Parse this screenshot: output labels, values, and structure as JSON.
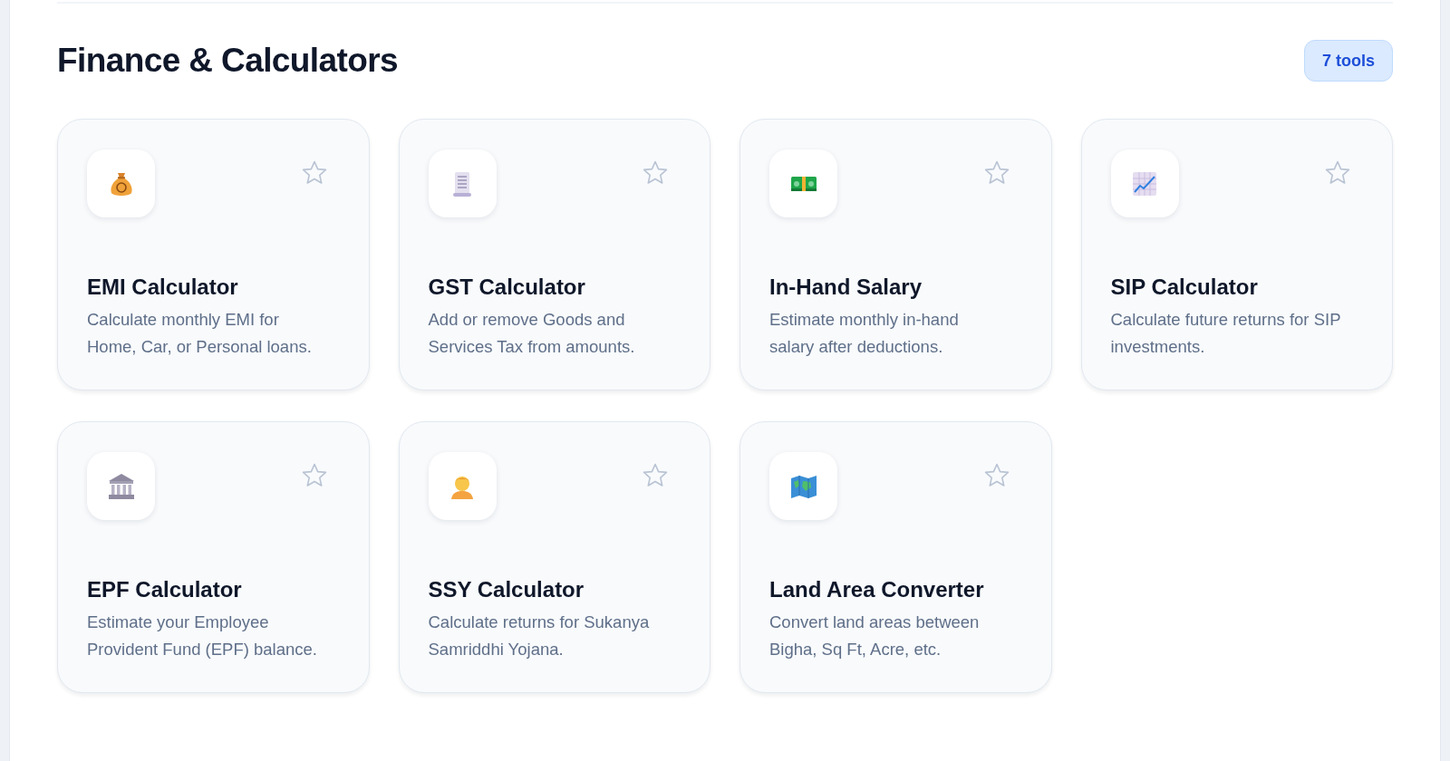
{
  "section": {
    "title": "Finance & Calculators",
    "count_badge": "7 tools"
  },
  "tools": [
    {
      "name": "EMI Calculator",
      "description": "Calculate monthly EMI for Home, Car, or Personal loans.",
      "favorite": false
    },
    {
      "name": "GST Calculator",
      "description": "Add or remove Goods and Services Tax from amounts.",
      "favorite": false
    },
    {
      "name": "In-Hand Salary",
      "description": "Estimate monthly in-hand salary after deductions.",
      "favorite": false
    },
    {
      "name": "SIP Calculator",
      "description": "Calculate future returns for SIP investments.",
      "favorite": false
    },
    {
      "name": "EPF Calculator",
      "description": "Estimate your Employee Provident Fund (EPF) balance.",
      "favorite": false
    },
    {
      "name": "SSY Calculator",
      "description": "Calculate returns for Sukanya Samriddhi Yojana.",
      "favorite": false
    },
    {
      "name": "Land Area Converter",
      "description": "Convert land areas between Bigha, Sq Ft, Acre, etc.",
      "favorite": false
    }
  ]
}
